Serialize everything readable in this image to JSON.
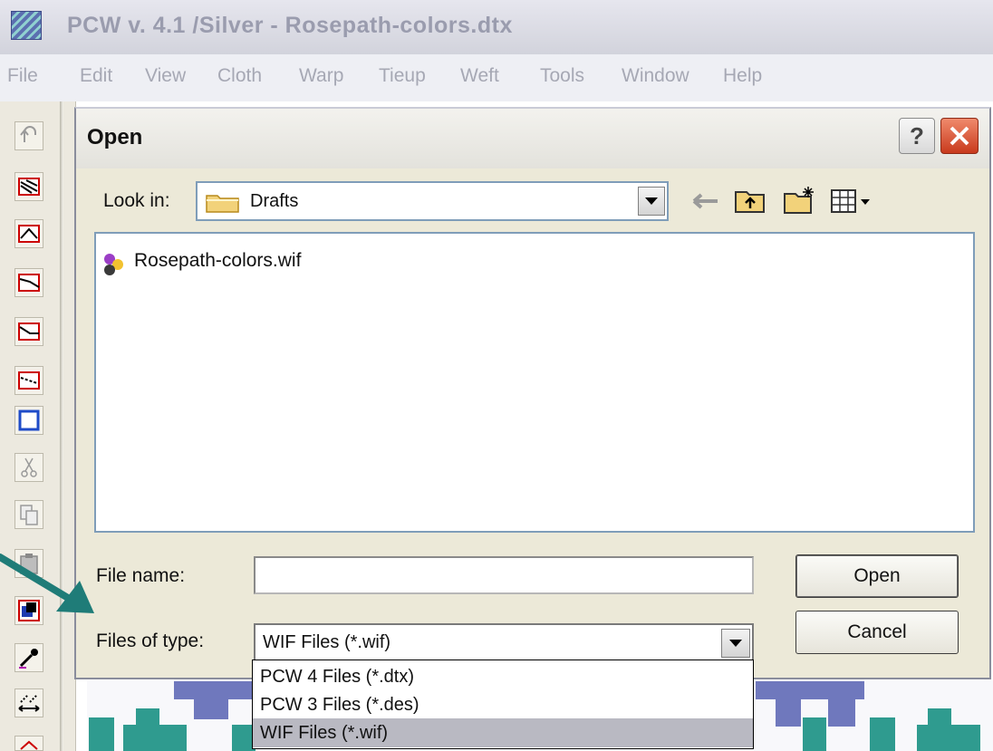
{
  "app": {
    "title": "PCW v. 4.1 /Silver - Rosepath-colors.dtx",
    "menus": [
      "File",
      "Edit",
      "View",
      "Cloth",
      "Warp",
      "Tieup",
      "Weft",
      "Tools",
      "Window",
      "Help"
    ]
  },
  "dialog": {
    "title": "Open",
    "help_glyph": "?",
    "look_in_label": "Look in:",
    "look_in_value": "Drafts",
    "files": [
      {
        "name": "Rosepath-colors.wif",
        "icon": "wif-file-icon"
      }
    ],
    "file_name_label": "File name:",
    "file_name_value": "",
    "files_of_type_label": "Files of type:",
    "files_of_type_value": "WIF Files (*.wif)",
    "file_type_options": [
      "PCW 4 Files (*.dtx)",
      "PCW 3 Files (*.des)",
      "WIF Files (*.wif)"
    ],
    "selected_option": "WIF Files (*.wif)",
    "open_label": "Open",
    "cancel_label": "Cancel"
  },
  "icons": {
    "back": "back-arrow-icon",
    "up": "up-folder-icon",
    "new_folder": "new-folder-icon",
    "views": "views-menu-icon"
  },
  "colors": {
    "accent_arrow": "#1f7c78",
    "close_button": "#d24a2a",
    "weave_blue": "#6f78bd",
    "weave_teal": "#2f9b8f",
    "list_selection": "#b9b9c2"
  }
}
